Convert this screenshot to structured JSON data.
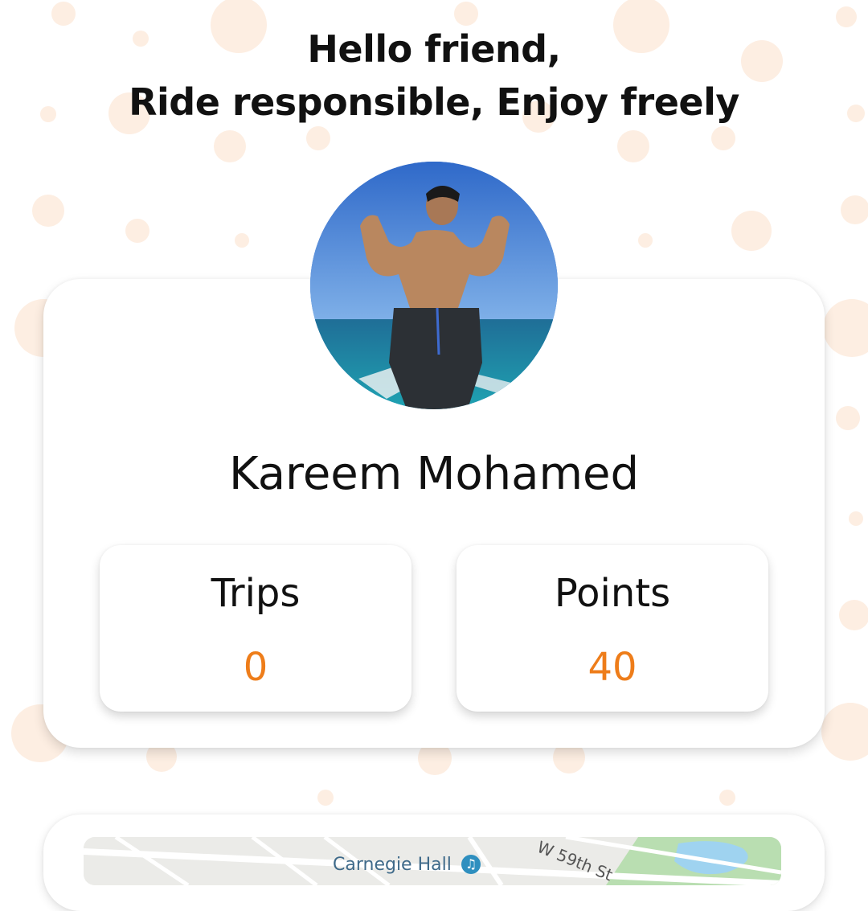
{
  "greeting": {
    "line1": "Hello friend,",
    "line2": "Ride responsible, Enjoy freely"
  },
  "profile": {
    "name": "Kareem Mohamed",
    "avatar_alt": "Profile photo"
  },
  "stats": {
    "trips": {
      "label": "Trips",
      "value": "0"
    },
    "points": {
      "label": "Points",
      "value": "40"
    }
  },
  "map": {
    "street_label": "W 59th St",
    "poi_label": "Carnegie Hall",
    "poi_icon": "music-note-icon"
  },
  "colors": {
    "accent": "#ee7d1a",
    "background_dot": "#fdeee2",
    "text": "#111111",
    "card": "#ffffff"
  }
}
